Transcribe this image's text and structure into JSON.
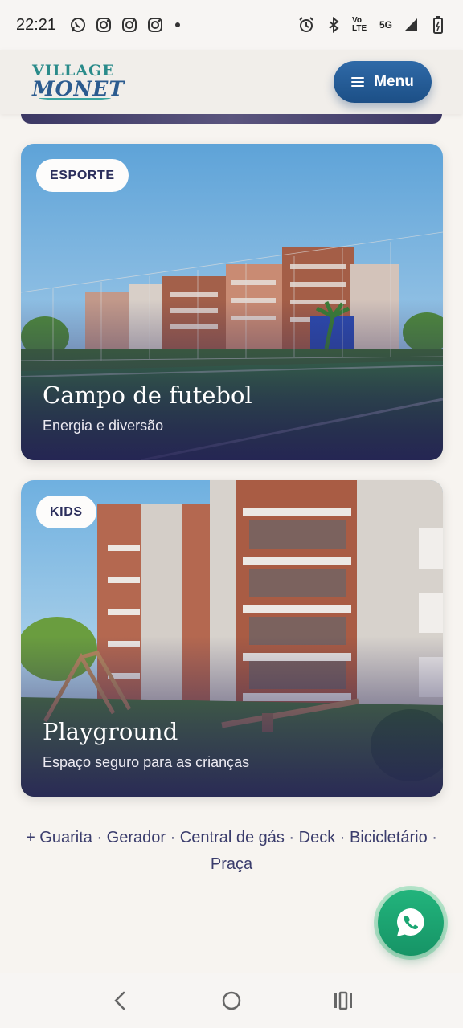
{
  "status_bar": {
    "time": "22:21",
    "volte_label": "Vo LTE",
    "network": "5G",
    "left_icons": [
      "whatsapp-icon",
      "instagram-icon",
      "instagram-icon",
      "instagram-icon"
    ],
    "right_icons": [
      "alarm-icon",
      "bluetooth-icon",
      "signal-icon",
      "battery-icon"
    ]
  },
  "header": {
    "logo_top": "VILLAGE",
    "logo_bottom": "MONET",
    "menu_label": "Menu"
  },
  "cards": [
    {
      "tag": "ESPORTE",
      "title": "Campo de futebol",
      "subtitle": "Energia e diversão"
    },
    {
      "tag": "KIDS",
      "title": "Playground",
      "subtitle": "Espaço seguro para as crianças"
    }
  ],
  "extras_text": "+ Guarita · Gerador · Central de gás · Deck · Bicicletário · Praça",
  "colors": {
    "page_bg": "#f7f4f0",
    "menu_button": "#1f548c",
    "accent_text": "#2d2f5c",
    "whatsapp": "#1aa672"
  }
}
